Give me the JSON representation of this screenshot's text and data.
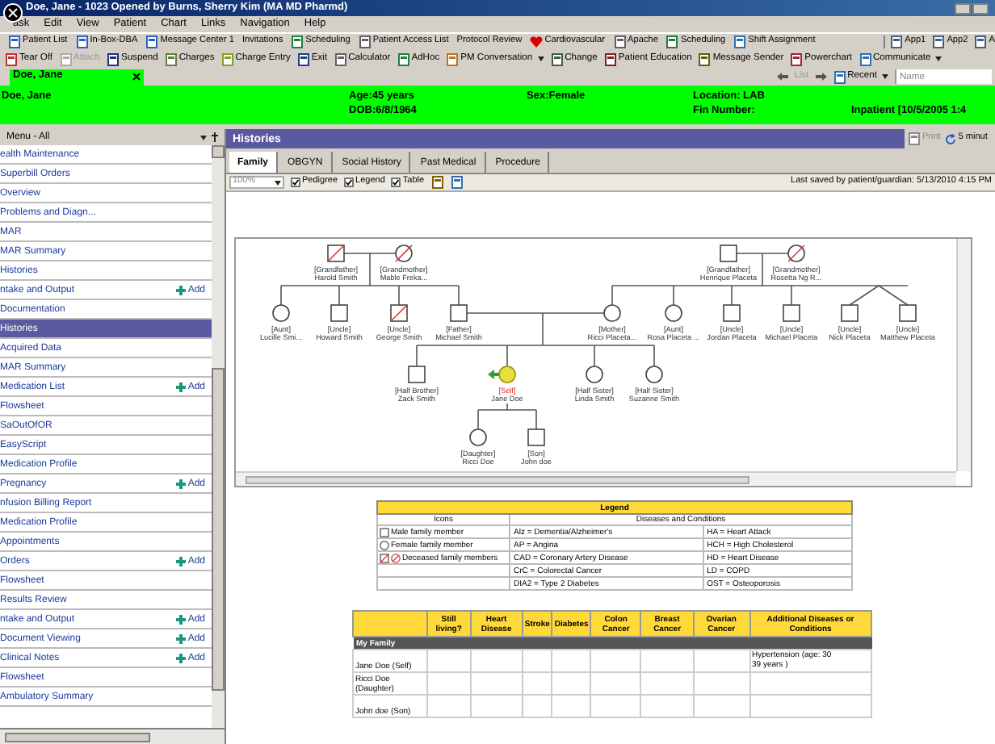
{
  "window": {
    "title": "Doe, Jane - 1023 Opened by Burns, Sherry Kim (MA MD Pharmd)"
  },
  "menu_bar": [
    "ask",
    "Edit",
    "View",
    "Patient",
    "Chart",
    "Links",
    "Navigation",
    "Help"
  ],
  "toolbar_1": {
    "items": [
      "Patient List",
      "In-Box-DBA",
      "Message Center 1",
      "Invitations",
      "Scheduling",
      "Patient Access List",
      "Protocol Review",
      "Cardiovascular",
      "Apache",
      "Scheduling",
      "Shift Assignment"
    ],
    "apps": [
      "App1",
      "App2",
      "A"
    ]
  },
  "toolbar_2": [
    {
      "label": "Tear Off",
      "disabled": false,
      "menu": false
    },
    {
      "label": "Attach",
      "disabled": true,
      "menu": false
    },
    {
      "label": "Suspend",
      "disabled": false,
      "menu": false
    },
    {
      "label": "Charges",
      "disabled": false,
      "menu": false
    },
    {
      "label": "Charge Entry",
      "disabled": false,
      "menu": false
    },
    {
      "label": "Exit",
      "disabled": false,
      "menu": false
    },
    {
      "label": "Calculator",
      "disabled": false,
      "menu": false
    },
    {
      "label": "AdHoc",
      "disabled": false,
      "menu": false
    },
    {
      "label": "PM Conversation",
      "disabled": false,
      "menu": true
    },
    {
      "label": "Change",
      "disabled": false,
      "menu": false
    },
    {
      "label": "Patient Education",
      "disabled": false,
      "menu": false
    },
    {
      "label": "Message Sender",
      "disabled": false,
      "menu": false
    },
    {
      "label": "Powerchart",
      "disabled": false,
      "menu": false
    },
    {
      "label": "Communicate",
      "disabled": false,
      "menu": true
    }
  ],
  "patient_tab": {
    "label": "Doe, Jane"
  },
  "nav": {
    "list": "List",
    "recent": "Recent",
    "search_placeholder": "Name"
  },
  "banner": {
    "name": "Doe, Jane",
    "age": "Age:45 years",
    "dob": "DOB:6/8/1964",
    "sex": "Sex:Female",
    "location": "Location: LAB",
    "fin": "Fin Number:",
    "encounter": "Inpatient [10/5/2005 1:4"
  },
  "sidebar": {
    "title": "Menu - All",
    "items": [
      {
        "label": "ealth Maintenance",
        "selected": false,
        "add": false
      },
      {
        "label": "Superbill Orders",
        "selected": false,
        "add": false
      },
      {
        "label": "Overview",
        "selected": false,
        "add": false
      },
      {
        "label": "Problems and Diagn...",
        "selected": false,
        "add": false
      },
      {
        "label": "MAR",
        "selected": false,
        "add": false
      },
      {
        "label": "MAR Summary",
        "selected": false,
        "add": false
      },
      {
        "label": "Histories",
        "selected": false,
        "add": false
      },
      {
        "label": "ntake and Output",
        "selected": false,
        "add": "Add"
      },
      {
        "label": "Documentation",
        "selected": false,
        "add": false
      },
      {
        "label": "Histories",
        "selected": true,
        "add": false
      },
      {
        "label": "Acquired Data",
        "selected": false,
        "add": false
      },
      {
        "label": "MAR Summary",
        "selected": false,
        "add": false
      },
      {
        "label": "Medication List",
        "selected": false,
        "add": "Add"
      },
      {
        "label": "Flowsheet",
        "selected": false,
        "add": false
      },
      {
        "label": "SaOutOfOR",
        "selected": false,
        "add": false
      },
      {
        "label": "EasyScript",
        "selected": false,
        "add": false
      },
      {
        "label": "Medication Profile",
        "selected": false,
        "add": false
      },
      {
        "label": "Pregnancy",
        "selected": false,
        "add": "Add"
      },
      {
        "label": "nfusion Billing Report",
        "selected": false,
        "add": false
      },
      {
        "label": "Medication Profile",
        "selected": false,
        "add": false
      },
      {
        "label": "Appointments",
        "selected": false,
        "add": false
      },
      {
        "label": "Orders",
        "selected": false,
        "add": "Add"
      },
      {
        "label": "Flowsheet",
        "selected": false,
        "add": false
      },
      {
        "label": "Results Review",
        "selected": false,
        "add": false
      },
      {
        "label": "ntake and Output",
        "selected": false,
        "add": "Add"
      },
      {
        "label": "Document Viewing",
        "selected": false,
        "add": "Add"
      },
      {
        "label": "Clinical Notes",
        "selected": false,
        "add": "Add"
      },
      {
        "label": "Flowsheet",
        "selected": false,
        "add": false
      },
      {
        "label": "Ambulatory Summary",
        "selected": false,
        "add": false
      }
    ]
  },
  "panel": {
    "title": "Histories",
    "print": "Print",
    "refresh": "5 minut"
  },
  "tabs": [
    {
      "label": "Family",
      "selected": true
    },
    {
      "label": "OBGYN",
      "selected": false
    },
    {
      "label": "Social History",
      "selected": false
    },
    {
      "label": "Past Medical",
      "selected": false
    },
    {
      "label": "Procedure",
      "selected": false
    }
  ],
  "view_toolbar": {
    "zoom": "100%",
    "options": [
      {
        "label": "Pedigree",
        "checked": true
      },
      {
        "label": "Legend",
        "checked": true
      },
      {
        "label": "Table",
        "checked": true
      }
    ],
    "last_saved": "Last saved by patient/guardian:  5/13/2010 4:15 PM"
  },
  "pedigree": {
    "members": [
      {
        "relation": "[Grandfather]",
        "name": "Harold Smith",
        "kind": "male",
        "deceased": true,
        "selected": false
      },
      {
        "relation": "[Grandmother]",
        "name": "Mable Freka...",
        "kind": "female",
        "deceased": true,
        "selected": false
      },
      {
        "relation": "[Grandfather]",
        "name": "Henrique Placeta",
        "kind": "male",
        "deceased": false,
        "selected": false
      },
      {
        "relation": "[Grandmother]",
        "name": "Rosetta Ng R...",
        "kind": "female",
        "deceased": true,
        "selected": false
      },
      {
        "relation": "[Aunt]",
        "name": "Lucille Smi...",
        "kind": "female",
        "deceased": false,
        "selected": false
      },
      {
        "relation": "[Uncle]",
        "name": "Howard Smith",
        "kind": "male",
        "deceased": false,
        "selected": false
      },
      {
        "relation": "[Uncle]",
        "name": "George Smith",
        "kind": "male",
        "deceased": true,
        "selected": false
      },
      {
        "relation": "[Father]",
        "name": "Michael Smith",
        "kind": "male",
        "deceased": false,
        "selected": false
      },
      {
        "relation": "[Mother]",
        "name": "Ricci Placeta...",
        "kind": "female",
        "deceased": false,
        "selected": false
      },
      {
        "relation": "[Aunt]",
        "name": "Rosa Placeta ...",
        "kind": "female",
        "deceased": false,
        "selected": false
      },
      {
        "relation": "[Uncle]",
        "name": "Jordan Placeta",
        "kind": "male",
        "deceased": false,
        "selected": false
      },
      {
        "relation": "[Uncle]",
        "name": "Michael Placeta",
        "kind": "male",
        "deceased": false,
        "selected": false
      },
      {
        "relation": "[Uncle]",
        "name": "Nick Placeta",
        "kind": "male",
        "deceased": false,
        "selected": false
      },
      {
        "relation": "[Uncle]",
        "name": "Matthew Placeta",
        "kind": "male",
        "deceased": false,
        "selected": false
      },
      {
        "relation": "[Half Brother]",
        "name": "Zack Smith",
        "kind": "male",
        "deceased": false,
        "selected": false
      },
      {
        "relation": "[Self]",
        "name": "Jane Doe",
        "kind": "female",
        "deceased": false,
        "selected": true
      },
      {
        "relation": "[Half Sister]",
        "name": "Linda Smith",
        "kind": "female",
        "deceased": false,
        "selected": false
      },
      {
        "relation": "[Half Sister]",
        "name": "Suzanne Smith",
        "kind": "female",
        "deceased": false,
        "selected": false
      },
      {
        "relation": "[Daughter]",
        "name": "Ricci Doe",
        "kind": "female",
        "deceased": false,
        "selected": false
      },
      {
        "relation": "[Son]",
        "name": "John doe",
        "kind": "male",
        "deceased": false,
        "selected": false
      }
    ]
  },
  "legend": {
    "title": "Legend",
    "icons_heading": "Icons",
    "conditions_heading": "Diseases and Conditions",
    "icons": [
      {
        "kind": "male",
        "label": "Male family member"
      },
      {
        "kind": "female",
        "label": "Female family member"
      },
      {
        "kind": "deceased",
        "label": "Deceased family members"
      }
    ],
    "conditions": [
      [
        "Alz = Dementia/Alzheimer's",
        "HA = Heart Attack"
      ],
      [
        "AP = Angina",
        "HCH = High Cholesterol"
      ],
      [
        "CAD = Coronary Artery Disease",
        "HD = Heart Disease"
      ],
      [
        "CrC = Colorectal Cancer",
        "LD = COPD"
      ],
      [
        "DIA2 = Type 2 Diabetes",
        "OST = Osteoporosis"
      ]
    ]
  },
  "family_table": {
    "columns": [
      "Still living?",
      "Heart Disease",
      "Stroke",
      "Diabetes",
      "Colon Cancer",
      "Breast Cancer",
      "Ovarian Cancer",
      "Additional Diseases or Conditions"
    ],
    "section": "My Family",
    "rows": [
      {
        "name": "Jane Doe (Self)",
        "additional": [
          "Hypertension (age: 30",
          "39 years )"
        ]
      },
      {
        "name": "Ricci Doe (Daughter)",
        "additional": []
      },
      {
        "name": "John doe (Son)",
        "additional": []
      }
    ]
  }
}
